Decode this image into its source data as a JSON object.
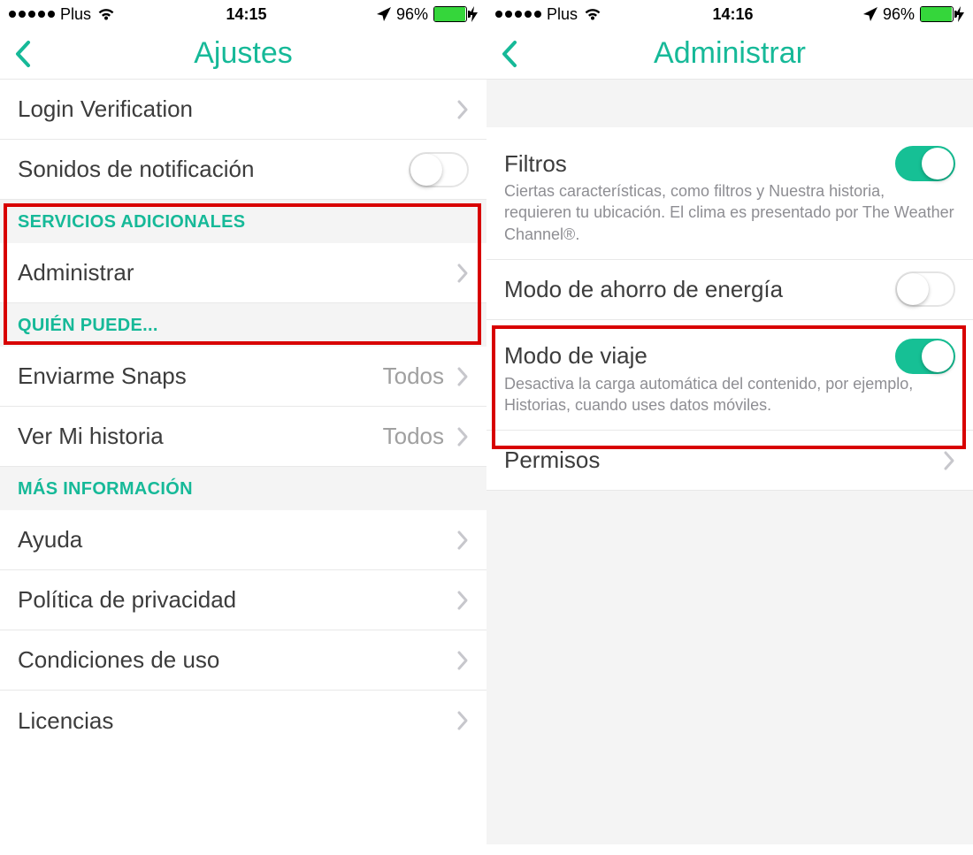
{
  "left": {
    "status": {
      "carrier": "Plus",
      "time": "14:15",
      "battery_pct": "96%"
    },
    "nav_title": "Ajustes",
    "rows": {
      "login_verification": "Login Verification",
      "notif_sounds": "Sonidos de notificación"
    },
    "section_servicios": "SERVICIOS ADICIONALES",
    "administrar": "Administrar",
    "section_quien": "QUIÉN PUEDE...",
    "enviarme_snaps": {
      "label": "Enviarme Snaps",
      "value": "Todos"
    },
    "ver_mi_historia": {
      "label": "Ver Mi historia",
      "value": "Todos"
    },
    "section_mas": "MÁS INFORMACIÓN",
    "ayuda": "Ayuda",
    "privacidad": "Política de privacidad",
    "condiciones": "Condiciones de uso",
    "licencias": "Licencias"
  },
  "right": {
    "status": {
      "carrier": "Plus",
      "time": "14:16",
      "battery_pct": "96%"
    },
    "nav_title": "Administrar",
    "filtros": {
      "label": "Filtros",
      "sub": "Ciertas características, como filtros y Nuestra historia, requieren tu ubicación. El clima es presentado por The Weather Channel®.",
      "on": true
    },
    "ahorro": {
      "label": "Modo de ahorro de energía",
      "on": false
    },
    "viaje": {
      "label": "Modo de viaje",
      "sub": "Desactiva la carga automática del contenido, por ejemplo, Historias, cuando uses datos móviles.",
      "on": true
    },
    "permisos": "Permisos"
  }
}
